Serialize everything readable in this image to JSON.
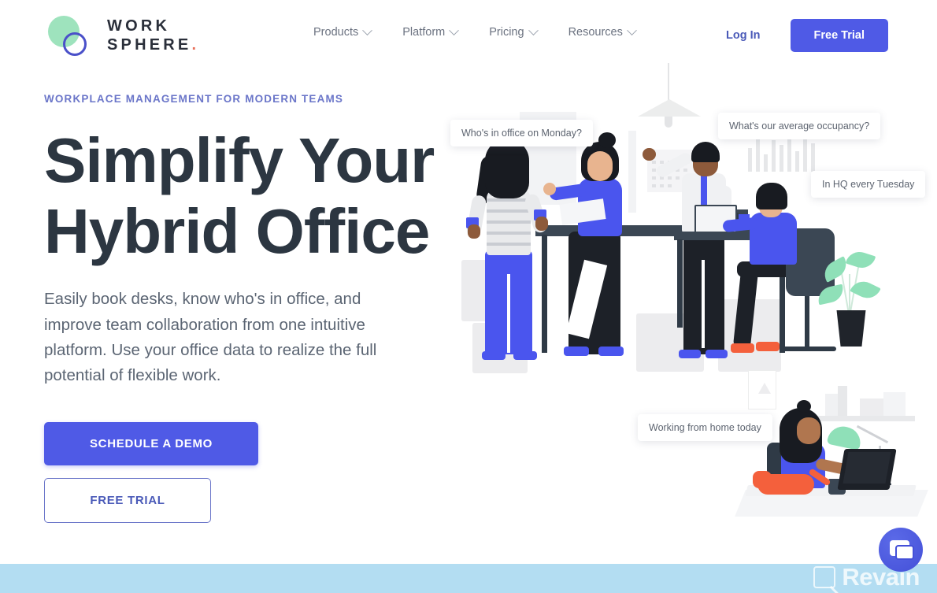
{
  "brand": {
    "logo_line1": "WORK",
    "logo_line2": "SPHERE",
    "logo_dot": ".",
    "green_circle_color": "#9ee3bd",
    "ring_color": "#4a50c9",
    "dot_color": "#e8705a"
  },
  "header": {
    "nav": [
      {
        "label": "Products",
        "has_dropdown": true
      },
      {
        "label": "Platform",
        "has_dropdown": true
      },
      {
        "label": "Pricing",
        "has_dropdown": true
      },
      {
        "label": "Resources",
        "has_dropdown": true
      }
    ],
    "login_label": "Log In",
    "free_trial_label": "Free Trial",
    "accent_color": "#4f5ae6"
  },
  "hero": {
    "eyebrow": "WORKPLACE MANAGEMENT FOR MODERN TEAMS",
    "headline_line1": "Simplify Your",
    "headline_line2": "Hybrid Office",
    "subhead": "Easily book desks, know who's in office, and improve team collaboration from one intuitive platform. Use your office data to realize the full potential of flexible work.",
    "primary_cta": "SCHEDULE A DEMO",
    "secondary_cta": "FREE TRIAL",
    "headline_color": "#2c3641",
    "eyebrow_color": "#6b76c9"
  },
  "illustration": {
    "bubbles": [
      {
        "text": "Who's in office on Monday?"
      },
      {
        "text": "What's our average occupancy?"
      },
      {
        "text": "In HQ every Tuesday"
      },
      {
        "text": "Working from home today"
      }
    ]
  },
  "footer": {
    "band_color": "#b3ddf2"
  },
  "widgets": {
    "chat_icon": "chat-bubble-icon",
    "watermark_text": "Revain"
  }
}
